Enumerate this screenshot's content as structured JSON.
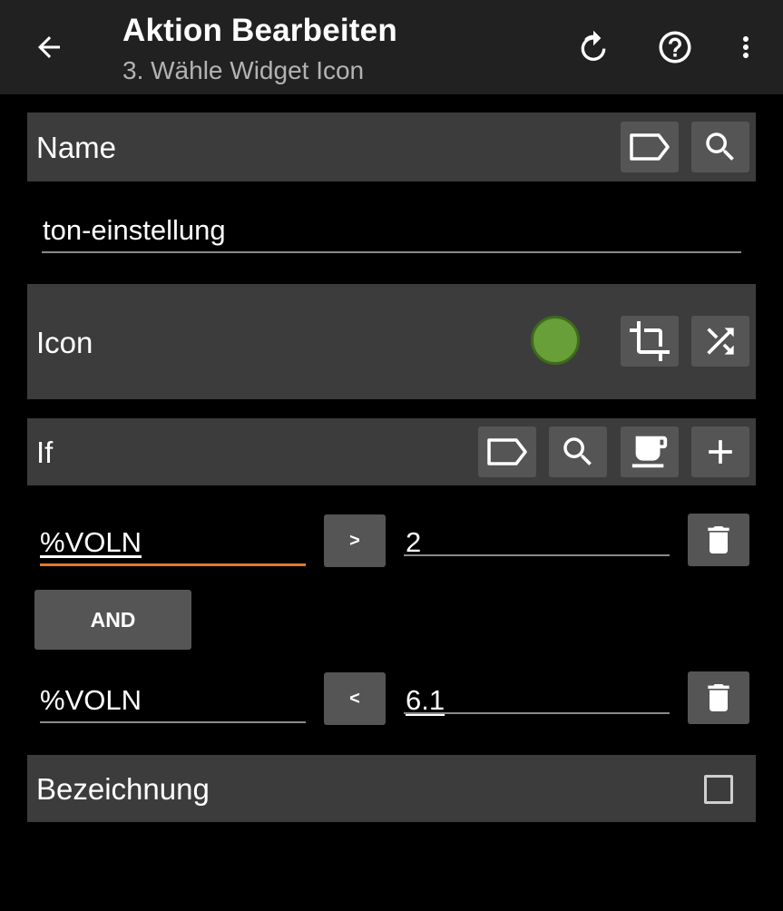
{
  "appbar": {
    "title": "Aktion Bearbeiten",
    "subtitle": "3. Wähle Widget Icon",
    "icons": [
      "back-arrow-icon",
      "undo-icon",
      "help-icon",
      "more-vert-icon"
    ]
  },
  "name_section": {
    "label": "Name",
    "value": "ton-einstellung",
    "buttons": [
      "label-tag-icon",
      "search-icon"
    ]
  },
  "icon_section": {
    "label": "Icon",
    "icon_color": "#689f38",
    "buttons": [
      "crop-icon",
      "shuffle-icon"
    ]
  },
  "if_section": {
    "label": "If",
    "buttons": [
      "label-tag-icon",
      "search-icon",
      "coffee-icon",
      "plus-icon"
    ],
    "conditions": [
      {
        "left": "%VOLN",
        "operator": ">",
        "right": "2"
      },
      {
        "left": "%VOLN",
        "operator": "<",
        "right": "6.1"
      }
    ],
    "join_label": "AND"
  },
  "bezeichnung_section": {
    "label": "Bezeichnung",
    "checked": false
  },
  "colors": {
    "appbar": "#212121",
    "section": "#3c3c3c",
    "button": "#555555",
    "focus_underline": "#e07a2a"
  }
}
